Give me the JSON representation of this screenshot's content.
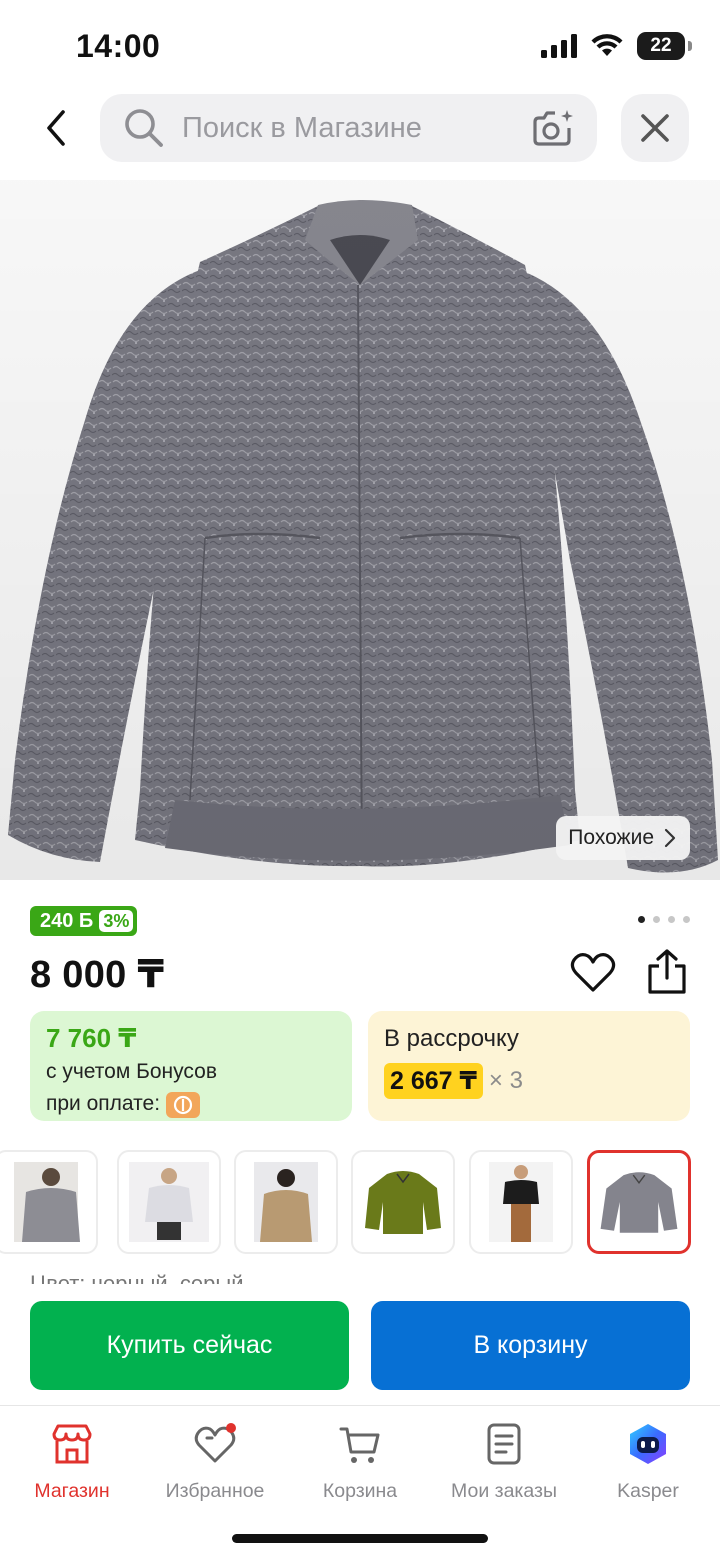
{
  "status_bar": {
    "time": "14:00",
    "battery": "22"
  },
  "search": {
    "placeholder": "Поиск в Магазине"
  },
  "product": {
    "similar_label": "Похожие",
    "bonus_amount": "240 Б",
    "bonus_percent": "3%",
    "price": "8 000 ₸",
    "image_count": 4,
    "active_image": 1
  },
  "bonus_card": {
    "price": "7 760 ₸",
    "line1": "с учетом Бонусов",
    "line2": "при оплате:"
  },
  "installment_card": {
    "label": "В рассрочку",
    "amount": "2 667 ₸",
    "multiplier": "× 3"
  },
  "variants": {
    "thumbnails": [
      "grey-jacket-on-model",
      "light-jacket-on-model",
      "beige-jacket-on-model",
      "olive-jacket",
      "black-jacket-on-model",
      "grey-jacket"
    ],
    "selected_index": 5,
    "color_label": "Цвет: черный, серый"
  },
  "actions": {
    "buy_now": "Купить сейчас",
    "add_to_cart": "В корзину"
  },
  "tabbar": {
    "items": [
      {
        "label": "Магазин",
        "icon": "store-icon"
      },
      {
        "label": "Избранное",
        "icon": "heart-icon"
      },
      {
        "label": "Корзина",
        "icon": "cart-icon"
      },
      {
        "label": "Мои заказы",
        "icon": "orders-icon"
      },
      {
        "label": "Kasper",
        "icon": "kasper-icon"
      }
    ],
    "active_index": 0
  },
  "colors": {
    "accent_red": "#e0322d",
    "buy_green": "#02b14f",
    "cart_blue": "#0770d4",
    "bonus_green": "#3aa716",
    "installment_yellow": "#ffd21f"
  }
}
